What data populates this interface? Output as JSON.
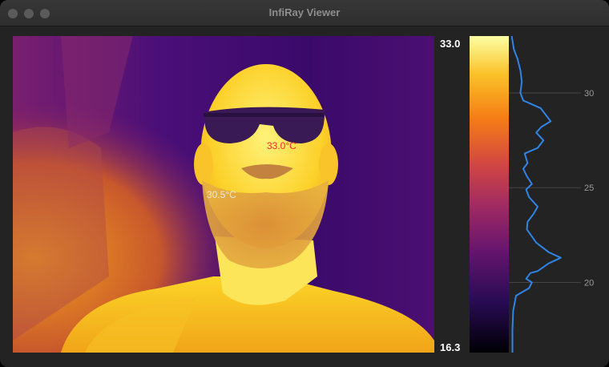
{
  "window": {
    "title": "InfiRay Viewer"
  },
  "thermal_view": {
    "hot_spot_label": "33.0°C",
    "hot_spot_color": "#ff2a2a",
    "cursor_label": "30.5°C",
    "cursor_color": "#e8e8e8"
  },
  "colorbar": {
    "max_label": "33.0",
    "min_label": "16.3",
    "colormap": "inferno"
  },
  "chart_data": {
    "type": "line",
    "orientation": "vertical",
    "ylim": [
      16.3,
      33.0
    ],
    "y_ticks": [
      20,
      25,
      30
    ],
    "y_tick_labels": [
      "20",
      "25",
      "30"
    ],
    "grid": true,
    "series": [
      {
        "color": "#2f84e6",
        "points": [
          [
            0.05,
            16.3
          ],
          [
            0.05,
            17.5
          ],
          [
            0.06,
            18.5
          ],
          [
            0.1,
            19.3
          ],
          [
            0.28,
            19.7
          ],
          [
            0.32,
            20.0
          ],
          [
            0.24,
            20.2
          ],
          [
            0.3,
            20.5
          ],
          [
            0.4,
            20.6
          ],
          [
            0.55,
            21.0
          ],
          [
            0.72,
            21.3
          ],
          [
            0.55,
            21.6
          ],
          [
            0.38,
            22.1
          ],
          [
            0.25,
            22.8
          ],
          [
            0.26,
            23.2
          ],
          [
            0.34,
            23.6
          ],
          [
            0.4,
            24.0
          ],
          [
            0.28,
            24.5
          ],
          [
            0.24,
            24.9
          ],
          [
            0.32,
            25.2
          ],
          [
            0.25,
            25.6
          ],
          [
            0.2,
            26.0
          ],
          [
            0.26,
            26.3
          ],
          [
            0.22,
            26.8
          ],
          [
            0.4,
            27.1
          ],
          [
            0.48,
            27.5
          ],
          [
            0.38,
            27.9
          ],
          [
            0.45,
            28.2
          ],
          [
            0.58,
            28.5
          ],
          [
            0.52,
            28.8
          ],
          [
            0.44,
            29.2
          ],
          [
            0.2,
            29.6
          ],
          [
            0.16,
            30.0
          ],
          [
            0.18,
            30.6
          ],
          [
            0.16,
            31.2
          ],
          [
            0.12,
            31.8
          ],
          [
            0.07,
            32.3
          ],
          [
            0.04,
            33.0
          ]
        ]
      }
    ]
  }
}
